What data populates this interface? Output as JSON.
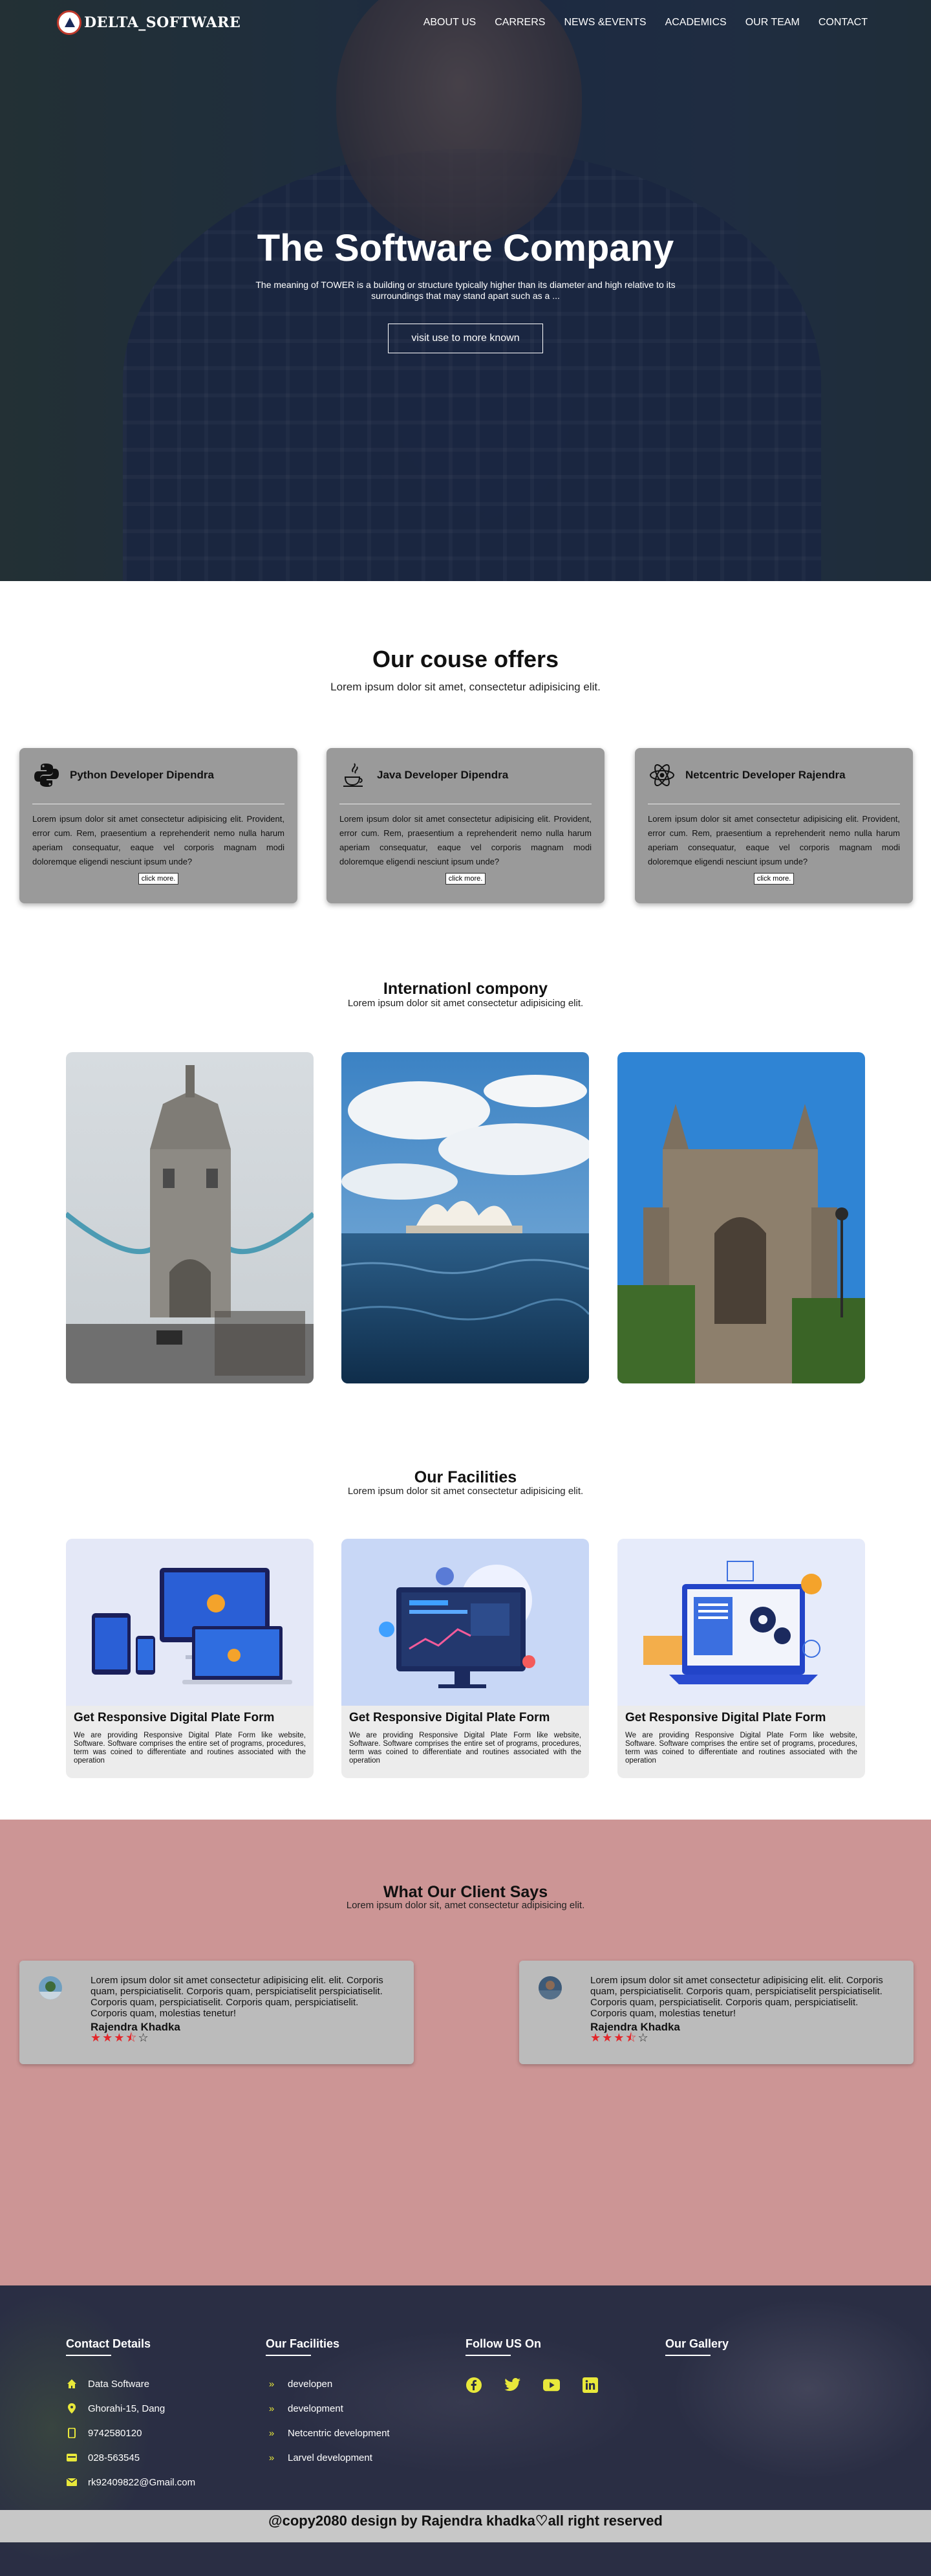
{
  "brand": {
    "name": "DELTA_SOFTWARE"
  },
  "nav": {
    "items": [
      "ABOUT US",
      "CARRERS",
      "NEWS &EVENTS",
      "ACADEMICS",
      "OUR TEAM",
      "CONTACT"
    ]
  },
  "hero": {
    "title": "The Software Company",
    "subtitle": "The meaning of TOWER is a building or structure typically higher than its diameter and high relative to its surroundings that may stand apart such as a ...",
    "button": "visit use to more known"
  },
  "courses": {
    "title": "Our couse offers",
    "subtitle": "Lorem ipsum dolor sit amet, consectetur adipisicing elit.",
    "cards": [
      {
        "icon": "python-icon",
        "title": "Python Developer Dipendra",
        "text": "Lorem ipsum dolor sit amet consectetur adipisicing elit. Provident, error cum. Rem, praesentium a reprehenderit nemo nulla harum aperiam consequatur, eaque vel corporis magnam modi doloremque eligendi nesciunt ipsum unde?",
        "button": "click more."
      },
      {
        "icon": "java-icon",
        "title": "Java Developer Dipendra",
        "text": "Lorem ipsum dolor sit amet consectetur adipisicing elit. Provident, error cum. Rem, praesentium a reprehenderit nemo nulla harum aperiam consequatur, eaque vel corporis magnam modi doloremque eligendi nesciunt ipsum unde?",
        "button": "click more."
      },
      {
        "icon": "atom-icon",
        "title": "Netcentric Developer Rajendra",
        "text": "Lorem ipsum dolor sit amet consectetur adipisicing elit. Provident, error cum. Rem, praesentium a reprehenderit nemo nulla harum aperiam consequatur, eaque vel corporis magnam modi doloremque eligendi nesciunt ipsum unde?",
        "button": "click more."
      }
    ]
  },
  "international": {
    "title": "Internationl compony",
    "subtitle": "Lorem ipsum dolor sit amet consectetur adipisicing elit."
  },
  "facilities": {
    "title": "Our Facilities",
    "subtitle": "Lorem ipsum dolor sit amet consectetur adipisicing elit.",
    "cards": [
      {
        "title": "Get Responsive Digital Plate Form",
        "text": "We are providing Responsive Digital Plate Form like website, Software. Software comprises the entire set of programs, procedures, term was coined to differentiate and routines associated with the operation"
      },
      {
        "title": "Get Responsive Digital Plate Form",
        "text": "We are providing Responsive Digital Plate Form like website, Software. Software comprises the entire set of programs, procedures, term was coined to differentiate and routines associated with the operation"
      },
      {
        "title": "Get Responsive Digital Plate Form",
        "text": "We are providing Responsive Digital Plate Form like website, Software. Software comprises the entire set of programs, procedures, term was coined to differentiate and routines associated with the operation"
      }
    ]
  },
  "clients": {
    "title": "What Our Client Says",
    "subtitle": "Lorem ipsum dolor sit, amet consectetur adipisicing elit.",
    "testimonials": [
      {
        "text": "Lorem ipsum dolor sit amet consectetur adipisicing elit. elit. Corporis quam, perspiciatiselit. Corporis quam, perspiciatiselit perspiciatiselit. Corporis quam, perspiciatiselit. Corporis quam, perspiciatiselit. Corporis quam, molestias tenetur!",
        "name": "Rajendra Khadka",
        "rating": 3.5
      },
      {
        "text": "Lorem ipsum dolor sit amet consectetur adipisicing elit. elit. Corporis quam, perspiciatiselit. Corporis quam, perspiciatiselit perspiciatiselit. Corporis quam, perspiciatiselit. Corporis quam, perspiciatiselit. Corporis quam, molestias tenetur!",
        "name": "Rajendra Khadka",
        "rating": 3.5
      }
    ]
  },
  "footer": {
    "contact": {
      "title": "Contact Details",
      "items": [
        {
          "icon": "home-icon",
          "text": "Data Software"
        },
        {
          "icon": "location-pin-icon",
          "text": "Ghorahi-15, Dang"
        },
        {
          "icon": "mobile-icon",
          "text": "9742580120"
        },
        {
          "icon": "phone-icon",
          "text": "028-563545"
        },
        {
          "icon": "envelope-icon",
          "text": "rk92409822@Gmail.com"
        }
      ]
    },
    "facilities": {
      "title": "Our Facilities",
      "items": [
        "developen",
        "development",
        "Netcentric development",
        "Larvel development"
      ]
    },
    "follow": {
      "title": "Follow US On",
      "icons": [
        "facebook-icon",
        "twitter-icon",
        "youtube-icon",
        "linkedin-icon"
      ]
    },
    "gallery": {
      "title": "Our Gallery"
    },
    "copyright": "@copy2080 design by Rajendra khadka♡all right reserved"
  },
  "colors": {
    "accent": "#e8e83a",
    "client_bg": "#cc9595",
    "card_gray": "#9a9a9a",
    "star": "#e3262a"
  }
}
